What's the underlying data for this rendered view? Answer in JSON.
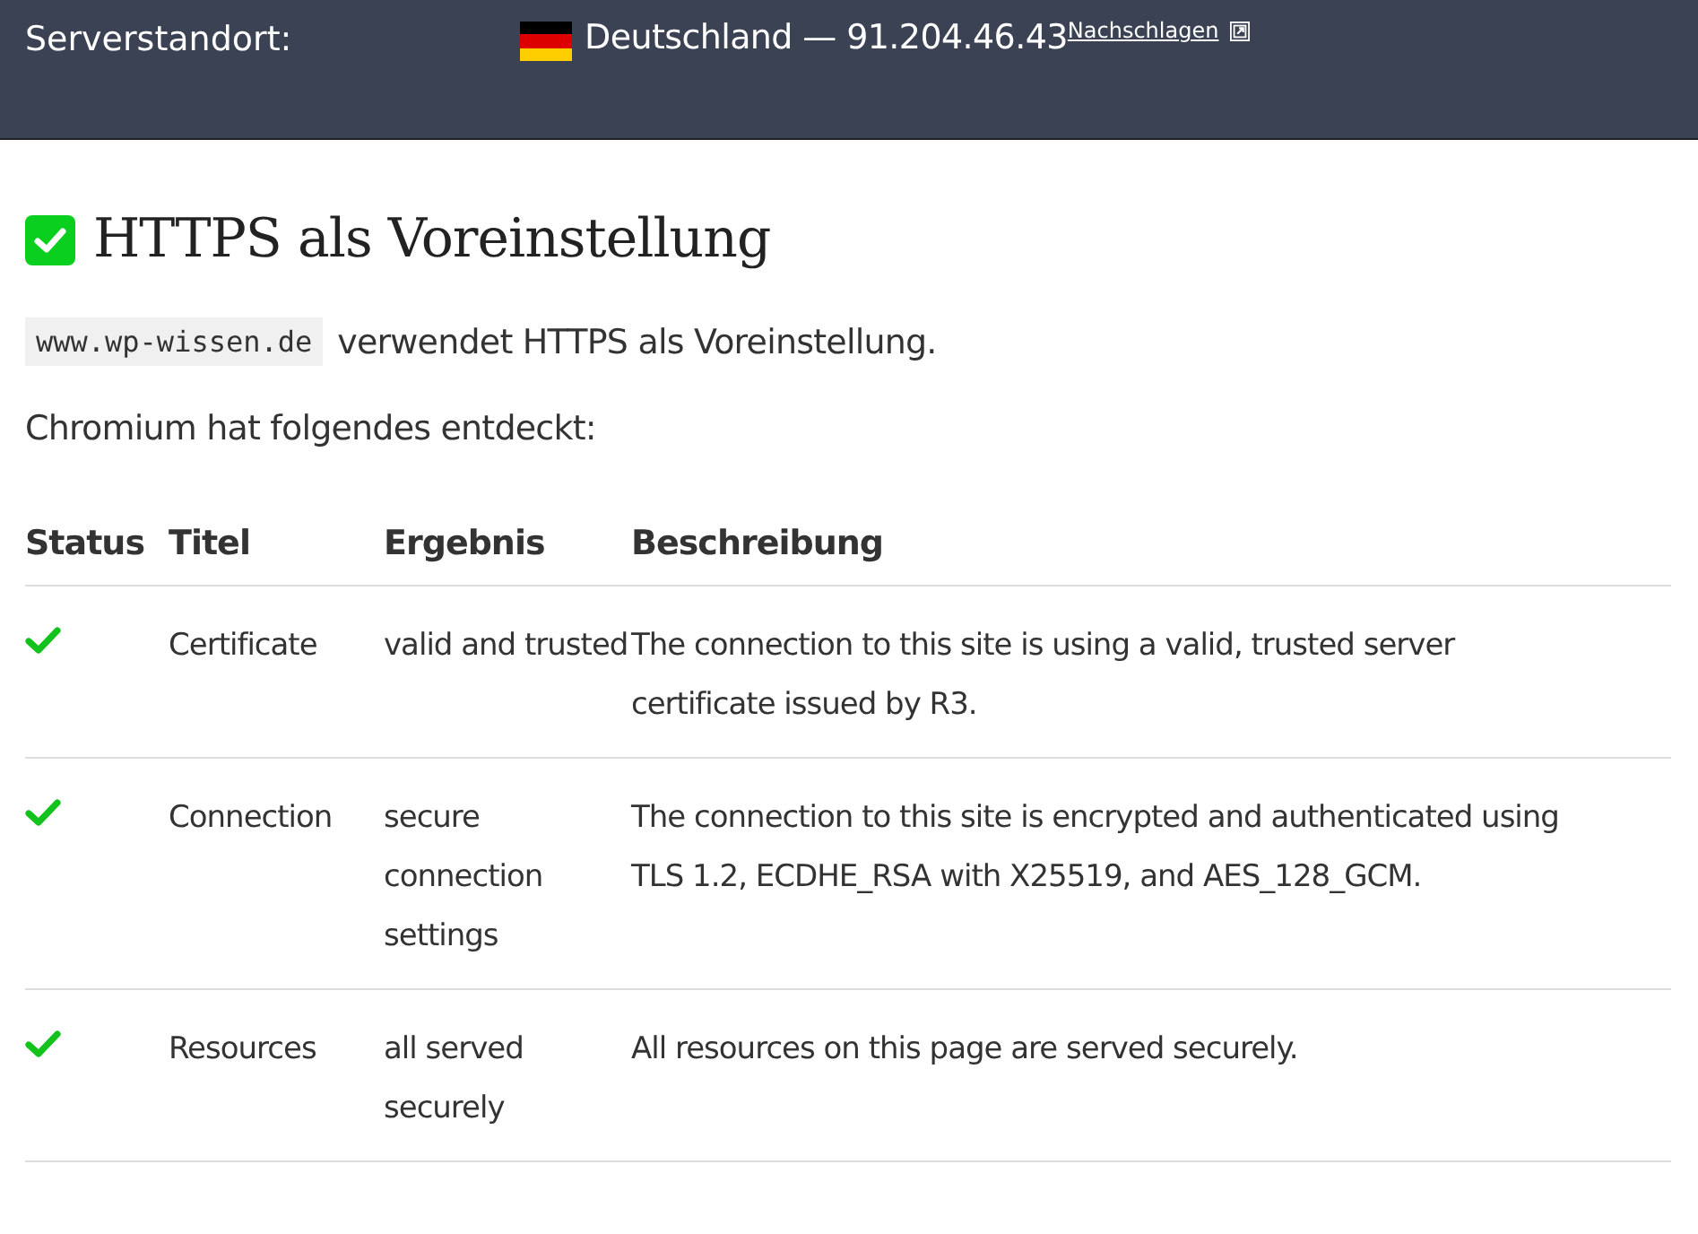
{
  "header": {
    "label": "Serverstandort:",
    "country": "Deutschland",
    "separator": "—",
    "ip": "91.204.46.43",
    "lookup_link": "Nachschlagen"
  },
  "section": {
    "title": "HTTPS als Voreinstellung",
    "passed": true,
    "domain": "www.wp-wissen.de",
    "sentence": "verwendet HTTPS als Voreinstellung.",
    "intro": "Chromium hat folgendes entdeckt:"
  },
  "table": {
    "columns": [
      "Status",
      "Titel",
      "Ergebnis",
      "Beschreibung"
    ],
    "rows": [
      {
        "passed": true,
        "title": "Certificate",
        "result": "valid and trusted",
        "description": "The connection to this site is using a valid, trusted server certificate issued by R3."
      },
      {
        "passed": true,
        "title": "Connection",
        "result": "secure connection settings",
        "description": "The connection to this site is encrypted and authenticated using TLS 1.2, ECDHE_RSA with X25519, and AES_128_GCM."
      },
      {
        "passed": true,
        "title": "Resources",
        "result": "all served securely",
        "description": "All resources on this page are served securely."
      }
    ]
  }
}
